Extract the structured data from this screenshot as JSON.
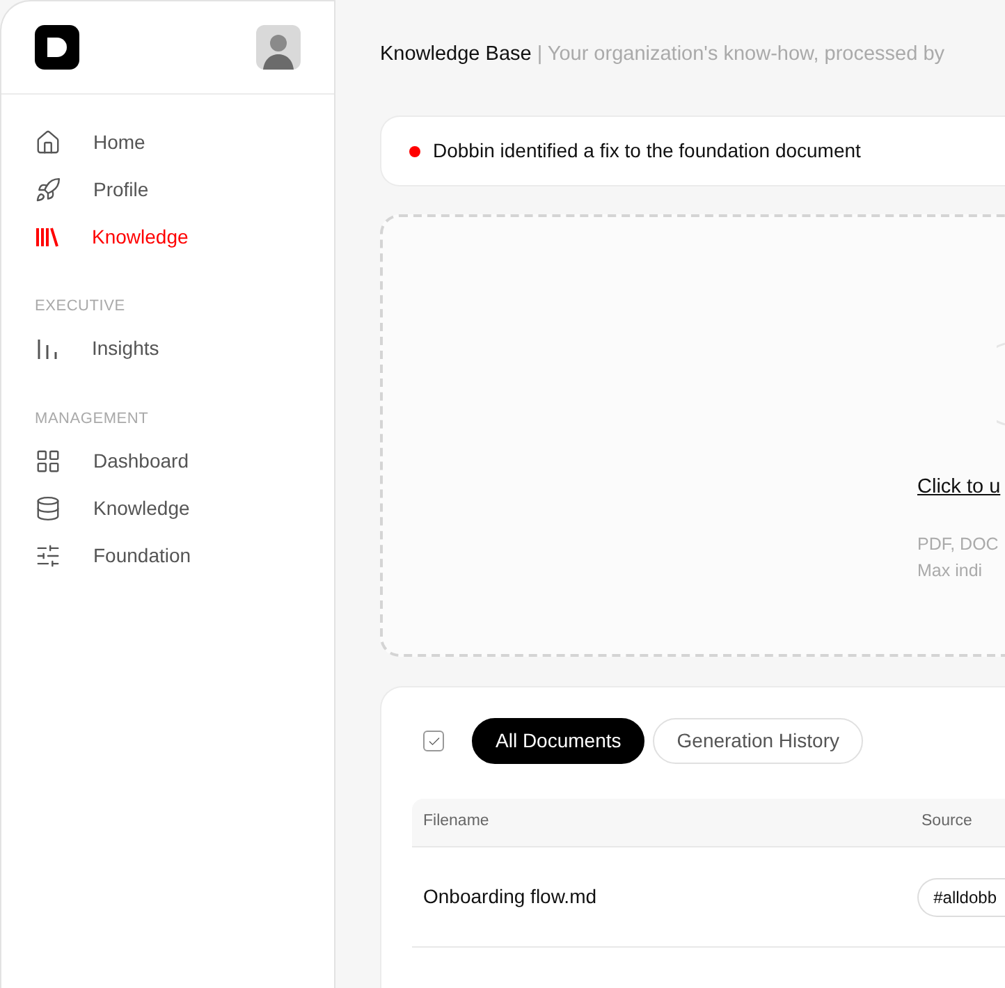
{
  "sidebar": {
    "sections": [
      {
        "items": [
          {
            "label": "Home",
            "selected": false
          },
          {
            "label": "Profile",
            "selected": false
          },
          {
            "label": "Knowledge",
            "selected": true
          }
        ]
      },
      {
        "title": "EXECUTIVE",
        "items": [
          {
            "label": "Insights",
            "selected": false
          }
        ]
      },
      {
        "title": "MANAGEMENT",
        "items": [
          {
            "label": "Dashboard",
            "selected": false
          },
          {
            "label": "Knowledge",
            "selected": false
          },
          {
            "label": "Foundation",
            "selected": false
          }
        ]
      }
    ]
  },
  "header": {
    "title": "Knowledge Base",
    "subtitle": "| Your organization's know-how, processed by"
  },
  "notification": {
    "text": "Dobbin identified a fix to the foundation document",
    "color": "#ff0000"
  },
  "upload": {
    "link": "Click to u",
    "hint_lines": [
      "PDF, DOC",
      "Max indi"
    ]
  },
  "documents": {
    "select_all_checked": true,
    "tabs": [
      {
        "label": "All Documents",
        "selected": true
      },
      {
        "label": "Generation History",
        "selected": false
      }
    ],
    "table": {
      "columns": [
        "Filename",
        "Source"
      ],
      "rows": [
        {
          "filename": "Onboarding flow.md",
          "source": "#alldobb"
        }
      ]
    }
  }
}
